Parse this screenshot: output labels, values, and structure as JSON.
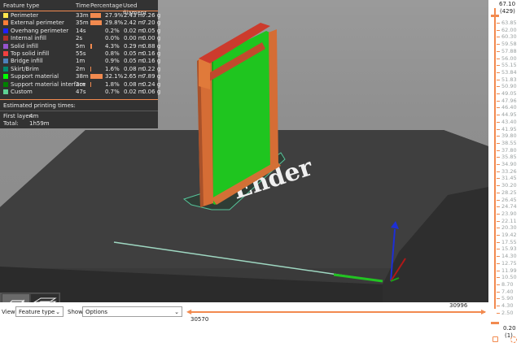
{
  "legend": {
    "headers": {
      "type": "Feature type",
      "time": "Time",
      "pct": "Percentage",
      "filament": "Used filament"
    },
    "rows": [
      {
        "name": "Perimeter",
        "time": "33m",
        "pct": "27.9%",
        "m": "2.43 m",
        "g": "7.26 g",
        "color": "#ffe64d",
        "bar": 0.279
      },
      {
        "name": "External perimeter",
        "time": "35m",
        "pct": "29.8%",
        "m": "2.42 m",
        "g": "7.20 g",
        "color": "#ff7d38",
        "bar": 0.298
      },
      {
        "name": "Overhang perimeter",
        "time": "14s",
        "pct": "0.2%",
        "m": "0.02 m",
        "g": "0.05 g",
        "color": "#1f1fff",
        "bar": 0.002
      },
      {
        "name": "Internal infill",
        "time": "2s",
        "pct": "0.0%",
        "m": "0.00 m",
        "g": "0.00 g",
        "color": "#b03029",
        "bar": 0.0
      },
      {
        "name": "Solid infill",
        "time": "5m",
        "pct": "4.3%",
        "m": "0.29 m",
        "g": "0.88 g",
        "color": "#9654cc",
        "bar": 0.043
      },
      {
        "name": "Top solid infill",
        "time": "55s",
        "pct": "0.8%",
        "m": "0.05 m",
        "g": "0.16 g",
        "color": "#f04040",
        "bar": 0.008
      },
      {
        "name": "Bridge infill",
        "time": "1m",
        "pct": "0.9%",
        "m": "0.05 m",
        "g": "0.16 g",
        "color": "#4d80ba",
        "bar": 0.009
      },
      {
        "name": "Skirt/Brim",
        "time": "2m",
        "pct": "1.6%",
        "m": "0.08 m",
        "g": "0.22 g",
        "color": "#00876e",
        "bar": 0.016
      },
      {
        "name": "Support material",
        "time": "38m",
        "pct": "32.1%",
        "m": "2.65 m",
        "g": "7.89 g",
        "color": "#00ff00",
        "bar": 0.321
      },
      {
        "name": "Support material interface",
        "time": "2m",
        "pct": "1.8%",
        "m": "0.08 m",
        "g": "0.24 g",
        "color": "#008000",
        "bar": 0.018
      },
      {
        "name": "Custom",
        "time": "47s",
        "pct": "0.7%",
        "m": "0.02 m",
        "g": "0.06 g",
        "color": "#5ed194",
        "bar": 0.007
      }
    ],
    "est_title": "Estimated printing times:",
    "first_layer_label": "First layer:",
    "first_layer_value": "4m",
    "total_label": "Total:",
    "total_value": "1h59m"
  },
  "scene": {
    "bed_text": "Ender",
    "icon_3d": "3d-cube-icon",
    "icon_layers": "layers-stack-icon"
  },
  "layer_slider": {
    "top_value": "67.10",
    "top_layer": "(429)",
    "bottom_value": "0.20",
    "bottom_layer": "(1)",
    "ticks": [
      "63.85",
      "62.00",
      "60.30",
      "59.58",
      "57.88",
      "56.00",
      "55.15",
      "53.84",
      "51.83",
      "50.90",
      "49.05",
      "47.96",
      "46.40",
      "44.95",
      "43.40",
      "41.95",
      "39.80",
      "38.55",
      "37.80",
      "35.85",
      "34.90",
      "33.26",
      "31.45",
      "30.20",
      "28.25",
      "26.45",
      "24.74",
      "23.90",
      "22.11",
      "20.30",
      "19.42",
      "17.55",
      "15.93",
      "14.30",
      "12.75",
      "11.99",
      "10.50",
      "8.70",
      "7.40",
      "5.90",
      "4.30",
      "2.50"
    ],
    "accent": "#f28a4f",
    "lock_icon": "lock-icon",
    "cog_icon": "cog-icon"
  },
  "toolbar": {
    "view_label": "View",
    "view_value": "Feature type",
    "show_label": "Show",
    "show_value": "Options",
    "slider_right_value": "30996",
    "slider_left_value": "30570"
  }
}
